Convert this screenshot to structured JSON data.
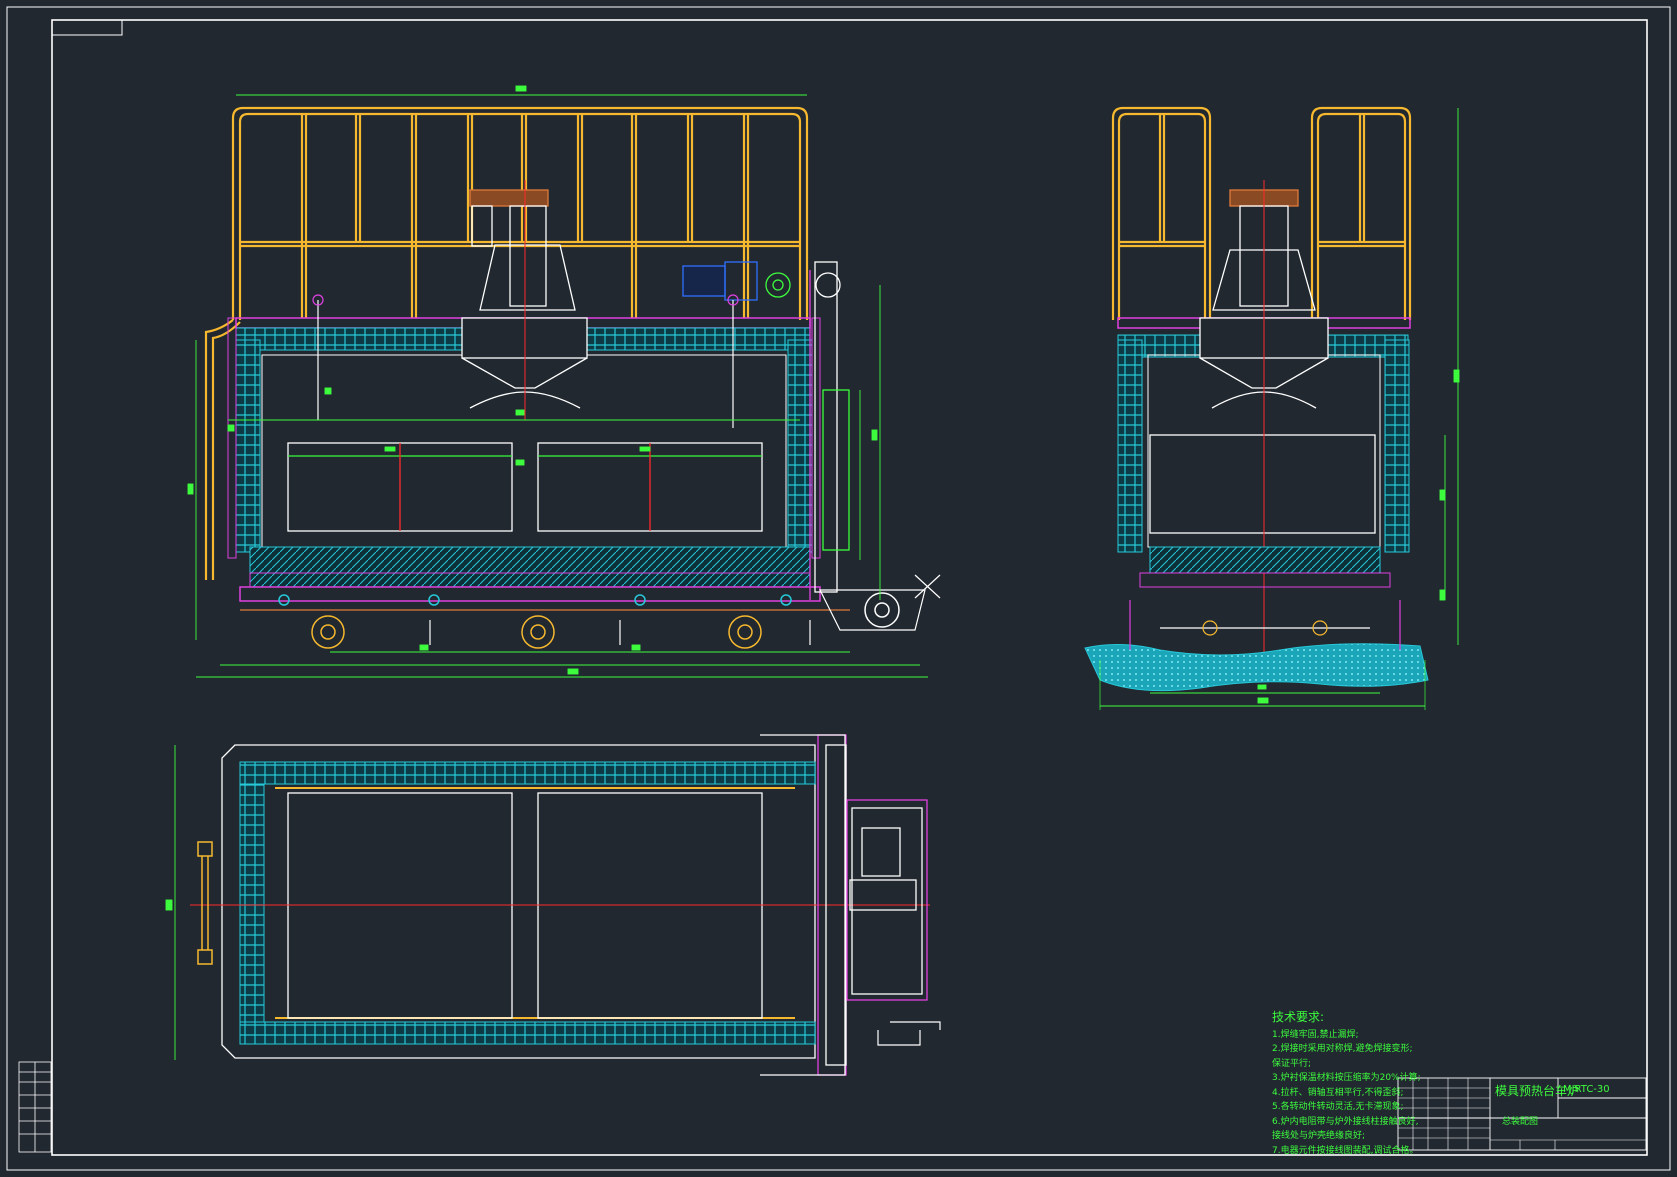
{
  "drawing": {
    "title": "模具预热台车炉",
    "drawing_no": "MJRTC-30",
    "sub_label": "总装配图"
  },
  "technical_requirements": {
    "heading": "技术要求:",
    "lines": [
      "1.焊缝牢固,禁止漏焊;",
      "2.焊接时采用对称焊,避免焊接变形;",
      "  保证平行;",
      "3.炉衬保温材料按压缩率为20%计算;",
      "4.拉杆、销轴互相平行,不得歪斜;",
      "5.各转动件转动灵活,无卡滞现象;",
      "6.炉内电阻带与炉外接线柱接触良好,",
      "  接线处与炉壳绝缘良好;",
      "7.电器元件按接线图装配,调试合格。"
    ]
  },
  "colors": {
    "background": "#212830",
    "frame": "#ffffff",
    "rail": "#f5b82e",
    "insulation": "#27c9d9",
    "structure": "#e040e0",
    "dimension": "#3dfc3d",
    "centerline": "#ff2a2a",
    "motor": "#2f6fff",
    "cover": "#c8693a"
  },
  "icons": {
    "motor": "motor-icon",
    "wheel": "wheel-icon",
    "thermocouple": "thermocouple-icon"
  }
}
